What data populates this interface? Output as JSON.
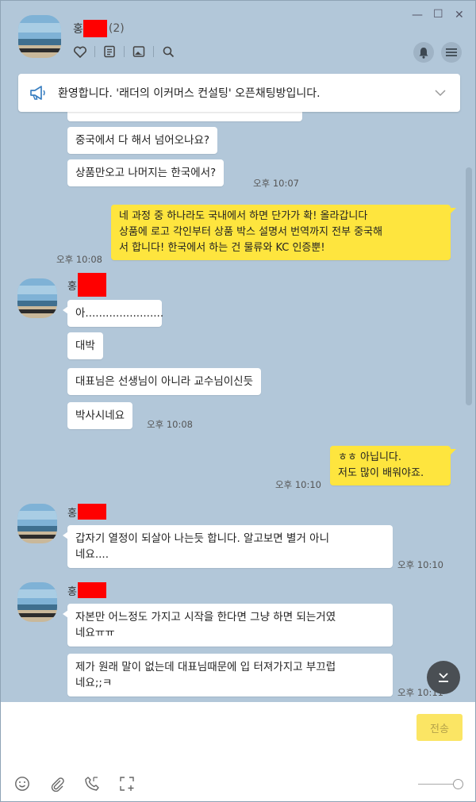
{
  "window": {
    "minimize": "—",
    "maximize": "☐",
    "close": "✕"
  },
  "header": {
    "name_visible": "홍",
    "member_count": "(2)"
  },
  "notice": {
    "text": "환영합니다. '래더의 이커머스 컨설팅' 오픈채팅방입니다."
  },
  "messages": {
    "m1": "중국에서 다 해서 넘어오나요?",
    "m2": "상품만오고 나머지는 한국에서?",
    "t1": "오후 10:07",
    "me1_l1": "네 과정 중 하나라도 국내에서 하면 단가가 확!  올라갑니다",
    "me1_l2": "상품에 로고 각인부터 상품 박스 설명서 번역까지 전부 중국해",
    "me1_l3": "서 합니다! 한국에서 하는 건 물류와 KC 인증뿐!",
    "t2": "오후 10:08",
    "sender": "홍",
    "m3": "아.......................",
    "m4": "대박",
    "m5": "대표님은 선생님이 아니라  교수님이신듯",
    "m6": "박사시네요",
    "t3": "오후 10:08",
    "me2_l1": "ㅎㅎ 아닙니다.",
    "me2_l2": "저도 많이 배워야죠.",
    "t4": "오후 10:10",
    "m7_l1": "갑자기 열정이 되살아 나는듯 합니다. 알고보면 별거 아니",
    "m7_l2": "네요....",
    "t5": "오후 10:10",
    "m8_l1": "자본만 어느정도 가지고 시작을 한다면 그냥 하면 되는거였",
    "m8_l2": "네요ㅠㅠ",
    "m9_l1": "제가 원래 말이 없는데 대표님때문에 입 터져가지고 부끄럽",
    "m9_l2": "네요;;ㅋ",
    "t6": "오후 10:11"
  },
  "input": {
    "send_label": "전송"
  },
  "colors": {
    "background": "#b2c7d9",
    "my_bubble": "#fee53e",
    "other_bubble": "#ffffff",
    "redaction": "#ff0000"
  }
}
